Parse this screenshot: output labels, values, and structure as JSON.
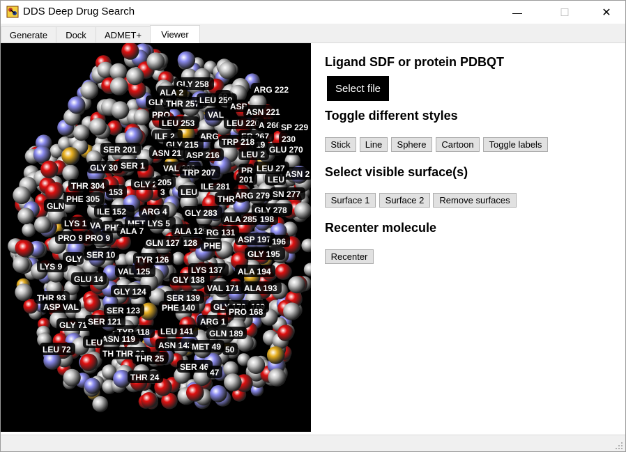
{
  "window": {
    "title": "DDS Deep Drug Search",
    "minimize_glyph": "—",
    "maximize_glyph": "☐",
    "close_glyph": "✕",
    "icon": "dds-app-icon"
  },
  "tabs": [
    {
      "label": "Generate",
      "active": false
    },
    {
      "label": "Dock",
      "active": false
    },
    {
      "label": "ADMET+",
      "active": false
    },
    {
      "label": "Viewer",
      "active": true
    }
  ],
  "panel": {
    "load_heading": "Ligand SDF or protein PDBQT",
    "select_file_label": "Select file",
    "styles_heading": "Toggle different styles",
    "style_buttons": [
      "Stick",
      "Line",
      "Sphere",
      "Cartoon",
      "Toggle labels"
    ],
    "surface_heading": "Select visible surface(s)",
    "surface_buttons": [
      "Surface 1",
      "Surface 2",
      "Remove surfaces"
    ],
    "recenter_heading": "Recenter molecule",
    "recenter_label": "Recenter"
  },
  "viewer": {
    "background": "#000000",
    "atom_colors": {
      "carbon": "#c8c8c8",
      "oxygen": "#e01010",
      "nitrogen": "#8c8cf0",
      "sulfur": "#e8b020"
    },
    "residue_labels": [
      "GLY 258",
      "ARG 222",
      "ALA 2",
      "60",
      "GLN",
      "THR 257",
      "LEU 259",
      "ASP",
      "ASN 221",
      "PRO",
      "VAL",
      "LEU 253",
      "LEU 220",
      "A 266",
      "SP 229",
      "ARG",
      "ER 267",
      "230",
      "ILE 2",
      "19",
      "GLU 270",
      "GLY 215",
      "TRP 218",
      "ASP 216",
      "SER 201",
      "ASN 21",
      "LEU 2",
      "GLY 30",
      "SER 1",
      "VAL 296",
      "TRP 207",
      "PR",
      "LEU 27",
      "ASN 2",
      "201",
      "LEU",
      "GLY 2",
      "205",
      "ILE 281",
      "THR 304",
      "153",
      "3",
      "LEU",
      "SN 277",
      "ARG 279",
      "THR",
      "PHE 305",
      "GLN",
      "ILE 152",
      "ARG 4",
      "GLY 283",
      "GLY 278",
      "LYS 1",
      "VA",
      "MET LYS 5",
      "ALA 285",
      "198",
      "PHE",
      "ALA 7",
      "ALA 129",
      "RG 131",
      "PRO 9",
      "PRO 9",
      "GLN 127",
      "128",
      "PHE",
      "ASP 197",
      "196",
      "SER 10",
      "TYR 126",
      "GLY 195",
      "LYS 9",
      "GLY",
      "VAL 125",
      "LYS 137",
      "ALA 194",
      "GLU 14",
      "GLY 138",
      "VAL 171",
      "ALA 193",
      "GLY 124",
      "THR 93",
      "SER 139",
      "GLY 170",
      "169",
      "ASP VAL",
      "SER 123",
      "PHE 140",
      "PRO 168",
      "ARG 1",
      "GLY 71",
      "SER 121",
      "TYR 118",
      "GLN 189",
      "LEU 141",
      "ASN 119",
      "LEU 72",
      "ASN 142",
      "MET 49",
      "50",
      "LEU",
      "TH THR 26",
      "THR 25",
      "SER 46",
      "THR 24",
      "47"
    ]
  }
}
